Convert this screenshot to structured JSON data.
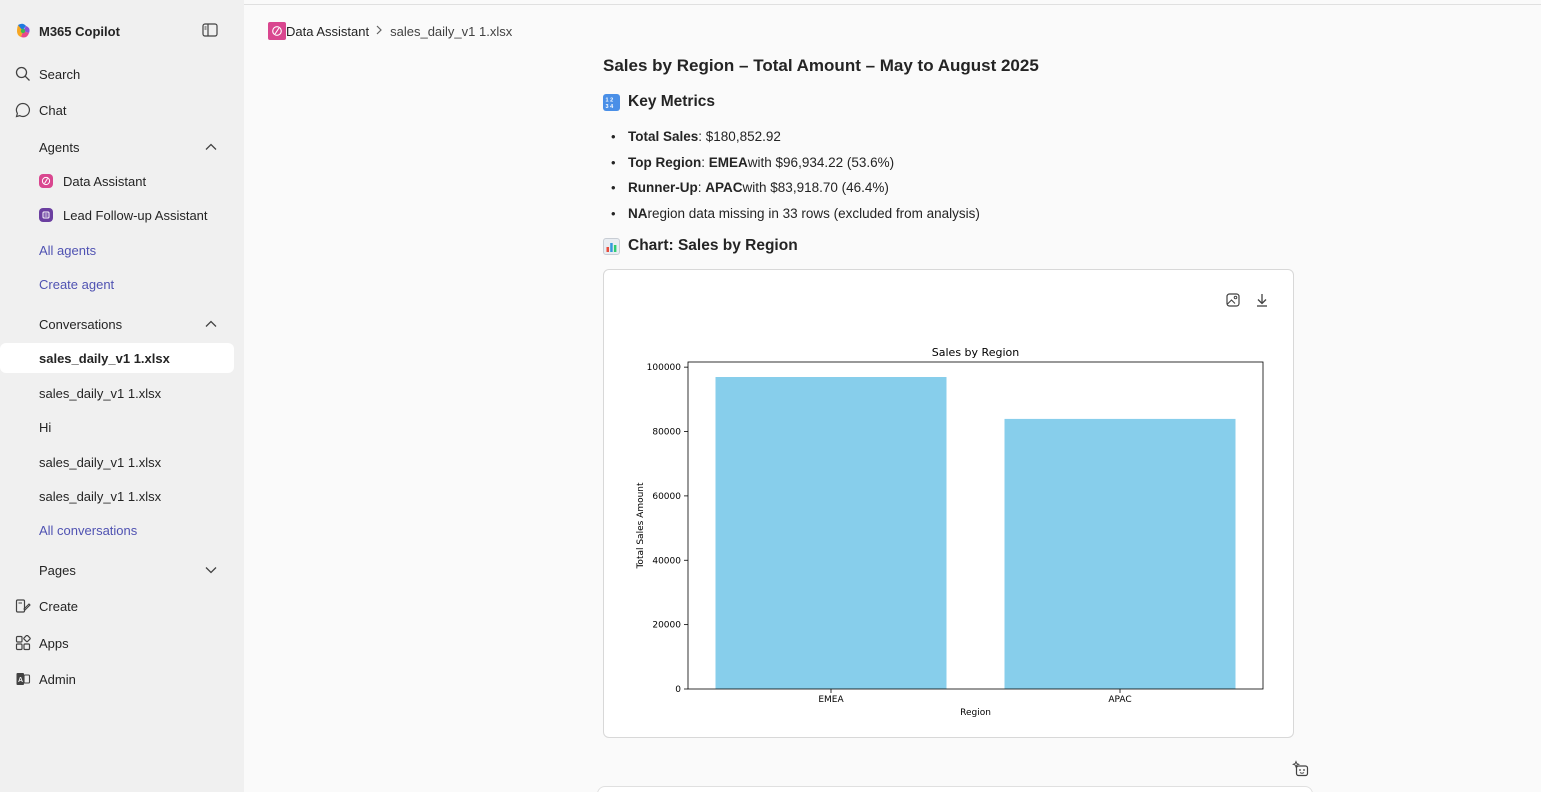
{
  "sidebar": {
    "brand": "M365 Copilot",
    "search": "Search",
    "chat": "Chat",
    "agents_header": "Agents",
    "agents": [
      {
        "label": "Data Assistant",
        "color": "#d9468f"
      },
      {
        "label": "Lead Follow-up Assistant",
        "color": "#6b3fa0"
      }
    ],
    "all_agents": "All agents",
    "create_agent": "Create agent",
    "conversations_header": "Conversations",
    "conversations": [
      {
        "label": "sales_daily_v1 1.xlsx",
        "active": true
      },
      {
        "label": "sales_daily_v1 1.xlsx",
        "active": false
      },
      {
        "label": "Hi",
        "active": false
      },
      {
        "label": "sales_daily_v1 1.xlsx",
        "active": false
      },
      {
        "label": "sales_daily_v1 1.xlsx",
        "active": false
      }
    ],
    "all_conversations": "All conversations",
    "pages": "Pages",
    "create": "Create",
    "apps": "Apps",
    "admin": "Admin"
  },
  "breadcrumb": {
    "agent": "Data Assistant",
    "file": "sales_daily_v1 1.xlsx"
  },
  "response": {
    "title": "Sales by Region – Total Amount – May to August 2025",
    "metrics_heading": "Key Metrics",
    "metrics": [
      {
        "label": "Total Sales",
        "value_text": ": $180,852.92"
      },
      {
        "label": "Top Region",
        "value_bold": "EMEA",
        "value_text": " with $96,934.22 (53.6%)"
      },
      {
        "label": "Runner-Up",
        "value_bold": "APAC",
        "value_text": " with $83,918.70 (46.4%)"
      },
      {
        "label": "NA",
        "value_text": " region data missing in 33 rows (excluded from analysis)"
      }
    ],
    "chart_heading": "Chart: Sales by Region"
  },
  "colors": {
    "accent_link": "#4f52b2",
    "bar": "#87ceeb",
    "agent_data_assistant": "#d9468f",
    "agent_lead_followup": "#6b3fa0"
  },
  "chart_data": {
    "type": "bar",
    "title": "Sales by Region",
    "xlabel": "Region",
    "ylabel": "Total Sales Amount",
    "categories": [
      "EMEA",
      "APAC"
    ],
    "values": [
      96934.22,
      83918.7
    ],
    "ylim": [
      0,
      101600
    ],
    "yticks": [
      0,
      20000,
      40000,
      60000,
      80000,
      100000
    ],
    "grid": false,
    "legend": "none"
  }
}
